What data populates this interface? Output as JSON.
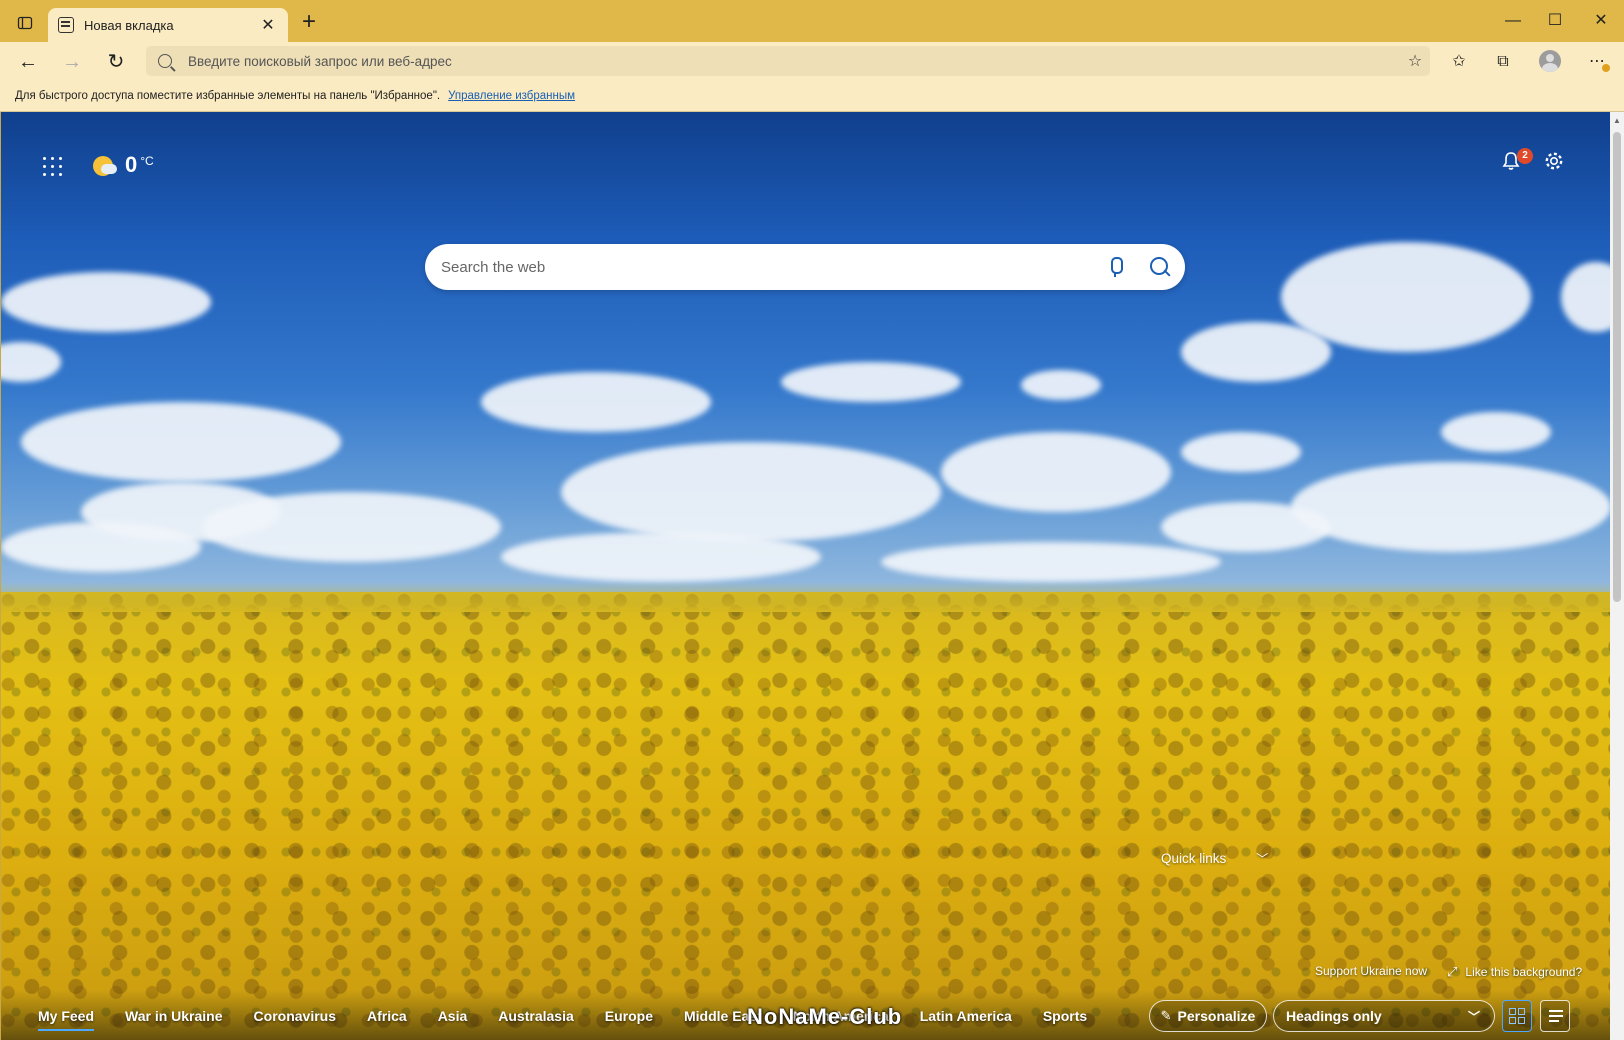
{
  "browser": {
    "tab_title": "Новая вкладка",
    "address_placeholder": "Введите поисковый запрос или веб-адрес",
    "favorites_hint": "Для быстрого доступа поместите избранные элементы на панель \"Избранное\".",
    "favorites_manage_link": "Управление избранным"
  },
  "newtab": {
    "temperature": "0",
    "temperature_unit": "°C",
    "notifications_count": "2",
    "search_placeholder": "Search the web",
    "quick_links_label": "Quick links",
    "support_link": "Support Ukraine now",
    "like_background": "Like this background?",
    "watermark": "NoNaMe-Club"
  },
  "feed": {
    "tabs": [
      {
        "label": "My Feed",
        "active": true
      },
      {
        "label": "War in Ukraine"
      },
      {
        "label": "Coronavirus"
      },
      {
        "label": "Africa"
      },
      {
        "label": "Asia"
      },
      {
        "label": "Australasia"
      },
      {
        "label": "Europe"
      },
      {
        "label": "Middle East"
      },
      {
        "label": "North America"
      },
      {
        "label": "Latin America"
      },
      {
        "label": "Sports"
      }
    ],
    "personalize_label": "Personalize",
    "layout_selected": "Headings only"
  },
  "colors": {
    "titlebar": "#e0b84a",
    "toolbar": "#faebc2",
    "accent": "#1a5fb4",
    "badge": "#e04a2a"
  }
}
